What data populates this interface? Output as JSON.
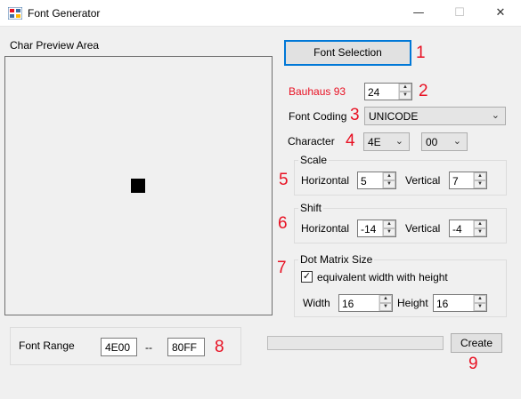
{
  "window": {
    "title": "Font Generator",
    "minimize": "—",
    "maximize": "☐",
    "close": "✕"
  },
  "preview": {
    "group_label": "Char Preview Area"
  },
  "font_selection": {
    "button_label": "Font Selection",
    "font_name": "Bauhaus 93",
    "font_size": "24"
  },
  "font_coding": {
    "label": "Font Coding",
    "value": "UNICODE"
  },
  "character": {
    "label": "Character",
    "high_byte": "4E",
    "low_byte": "00"
  },
  "scale": {
    "group_label": "Scale",
    "horizontal_label": "Horizontal",
    "horizontal_value": "5",
    "vertical_label": "Vertical",
    "vertical_value": "7"
  },
  "shift": {
    "group_label": "Shift",
    "horizontal_label": "Horizontal",
    "horizontal_value": "-14",
    "vertical_label": "Vertical",
    "vertical_value": "-4"
  },
  "dot_matrix": {
    "group_label": "Dot Matrix Size",
    "checkbox_label": "equivalent width with height",
    "checked": true,
    "width_label": "Width",
    "width_value": "16",
    "height_label": "Height",
    "height_value": "16"
  },
  "font_range": {
    "label": "Font Range",
    "start": "4E00",
    "separator": "--",
    "end": "80FF"
  },
  "create": {
    "button_label": "Create",
    "progress": 0
  },
  "annotations": [
    "1",
    "2",
    "3",
    "4",
    "5",
    "6",
    "7",
    "8",
    "9"
  ],
  "icons": {
    "app": "app-grid-icon",
    "spin_up": "spin-up-icon",
    "spin_down": "spin-down-icon",
    "dropdown": "chevron-down-icon",
    "check": "check-icon"
  },
  "colors": {
    "accent": "#0078d7",
    "annotation": "#e81123",
    "font_name": "#e81123"
  }
}
